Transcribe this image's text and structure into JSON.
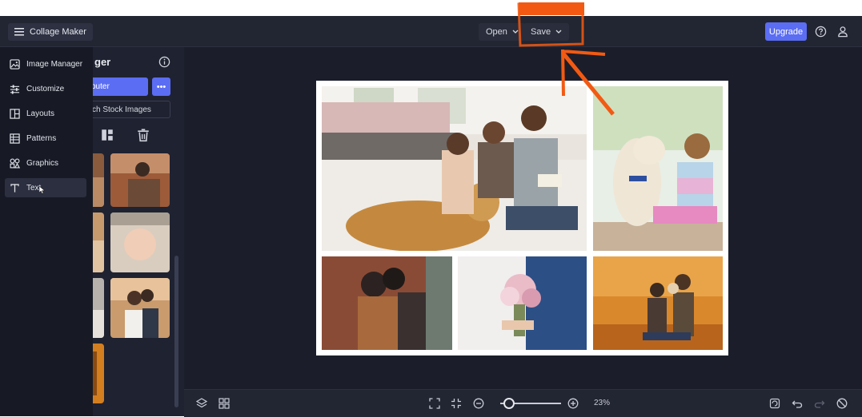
{
  "header": {
    "menu_label": "Collage Maker",
    "open_label": "Open",
    "save_label": "Save",
    "upgrade_label": "Upgrade",
    "help_icon": "help-circle-icon",
    "user_icon": "user-icon"
  },
  "side_menu": {
    "items": [
      {
        "label": "Image Manager",
        "icon": "image-icon"
      },
      {
        "label": "Customize",
        "icon": "sliders-icon"
      },
      {
        "label": "Layouts",
        "icon": "layout-icon"
      },
      {
        "label": "Patterns",
        "icon": "pattern-icon"
      },
      {
        "label": "Graphics",
        "icon": "shapes-icon"
      },
      {
        "label": "Text",
        "icon": "text-icon"
      }
    ]
  },
  "panel": {
    "title_partial": "ger",
    "upload_label_partial": "puter",
    "stock_label_partial": "ch Stock Images",
    "more_label": "•••"
  },
  "bottom_bar": {
    "zoom_label": "23%",
    "zoom_level": 0.15
  },
  "colors": {
    "accent": "#5b6df3",
    "annotation": "#f25a13"
  }
}
